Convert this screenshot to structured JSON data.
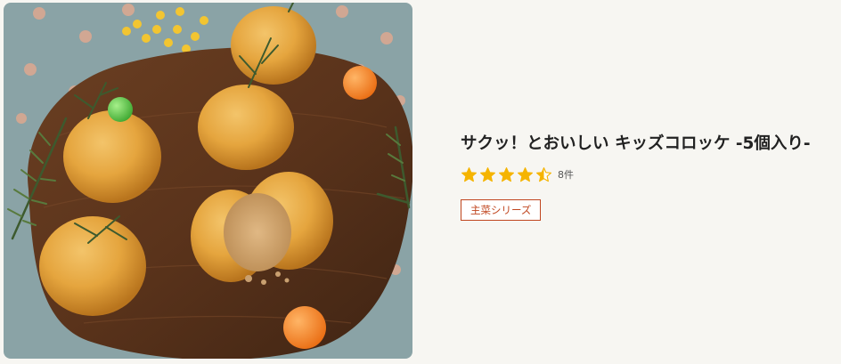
{
  "card": {
    "title": "サクッ！とおいしい キッズコロッケ -5個入り-",
    "rating": {
      "value": 4.5,
      "max": 5,
      "count_label": "8件",
      "star_color": "#f5b400",
      "star_empty_color": "#d9d9d9"
    },
    "tag": {
      "label": "主菜シリーズ",
      "color": "#c0451e"
    },
    "image": {
      "subject": "croquettes-on-wooden-board"
    }
  }
}
